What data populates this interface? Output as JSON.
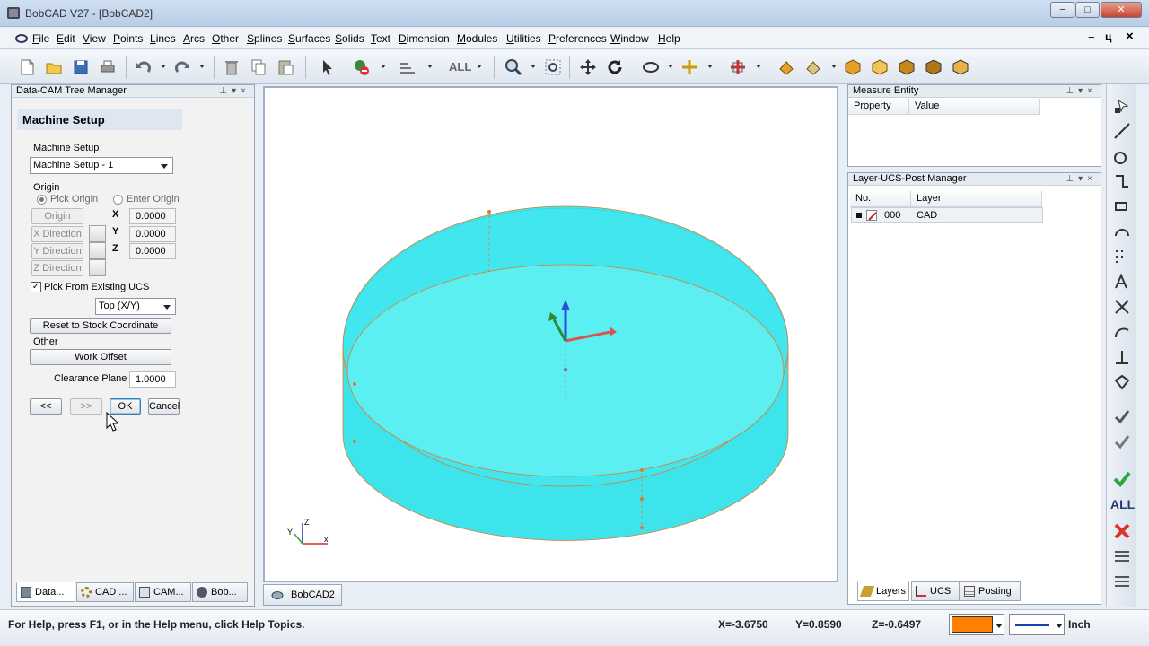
{
  "window": {
    "title": "BobCAD V27 - [BobCAD2]",
    "controls": {
      "minimize": "−",
      "maximize": "□",
      "close": "✕"
    },
    "mdi_controls": {
      "minimize": "−",
      "restore": "ц",
      "close": "×"
    }
  },
  "menu": [
    "File",
    "Edit",
    "View",
    "Points",
    "Lines",
    "Arcs",
    "Other",
    "Splines",
    "Surfaces",
    "Solids",
    "Text",
    "Dimension",
    "Modules",
    "Utilities",
    "Preferences",
    "Window",
    "Help"
  ],
  "toolbar": {
    "all_label": "ALL"
  },
  "left_panel": {
    "header": "Data-CAM Tree Manager",
    "section_title": "Machine Setup",
    "machine_setup_label": "Machine Setup",
    "machine_setup_value": "Machine Setup - 1",
    "origin_label": "Origin",
    "pick_origin": "Pick Origin",
    "enter_origin": "Enter Origin",
    "origin_btn": "Origin",
    "x_direction_btn": "X Direction",
    "y_direction_btn": "Y Direction",
    "z_direction_btn": "Z Direction",
    "x_label": "X",
    "y_label": "Y",
    "z_label": "Z",
    "x_value": "0.0000",
    "y_value": "0.0000",
    "z_value": "0.0000",
    "pick_existing_ucs": "Pick From Existing UCS",
    "pick_existing_checked": "✓",
    "ucs_value": "Top (X/Y)",
    "reset_btn": "Reset to Stock Coordinate",
    "other_label": "Other",
    "work_offset_btn": "Work Offset",
    "clearance_label": "Clearance Plane",
    "clearance_value": "1.0000",
    "prev_btn": "<<",
    "next_btn": ">>",
    "ok_btn": "OK",
    "cancel_btn": "Cancel",
    "tabs": [
      "Data...",
      "CAD ...",
      "CAM...",
      "Bob..."
    ]
  },
  "document_tab": "BobCAD2",
  "measure_panel": {
    "header": "Measure Entity",
    "columns": [
      "Property",
      "Value"
    ]
  },
  "layer_panel": {
    "header": "Layer-UCS-Post Manager",
    "columns": [
      "No.",
      "Layer"
    ],
    "rows": [
      {
        "no": "000",
        "layer": "CAD"
      }
    ],
    "tabs": [
      "Layers",
      "UCS",
      "Posting"
    ]
  },
  "right_toolbar": {
    "all_label": "ALL"
  },
  "status": {
    "help": "For Help, press F1, or in the Help menu, click Help Topics.",
    "x": "X=-3.6750",
    "y": "Y=0.8590",
    "z": "Z=-0.6497",
    "units": "Inch"
  },
  "colors": {
    "solid": "#3ee4ec",
    "solid_top": "#5ceff2",
    "edge": "#e07a2a",
    "axis_x": "#d9534f",
    "axis_y": "#2e8b3a",
    "axis_z": "#2a4fd6",
    "status_color": "#ff7f00"
  }
}
